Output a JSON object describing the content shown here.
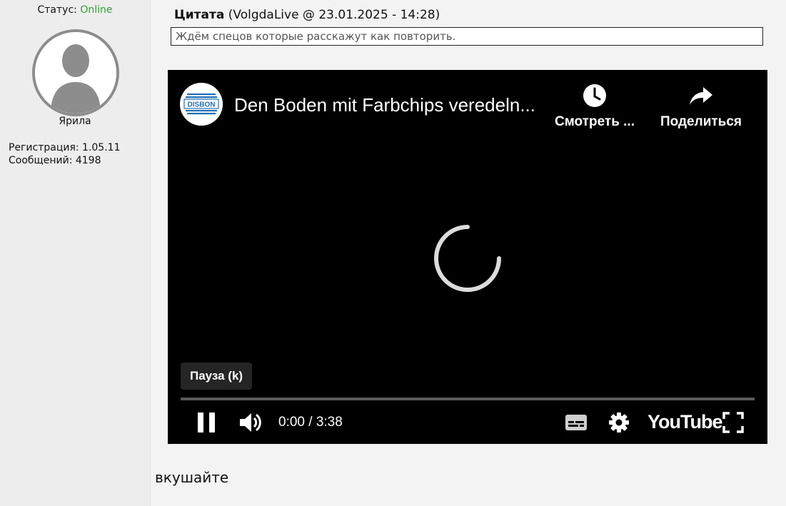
{
  "user": {
    "status_label": "Статус:",
    "status_value": "Online",
    "name": "Ярила",
    "registration": "Регистрация: 1.05.11",
    "messages": "Сообщений: 4198"
  },
  "quote": {
    "label": "Цитата",
    "source": "(VolgdaLive @ 23.01.2025 - 14:28)",
    "text": "Ждём спецов которые расскажут как повторить."
  },
  "video": {
    "channel_logo_text": "DISBON",
    "title": "Den Boden mit Farbchips veredeln...",
    "watch_later_label": "Смотреть ...",
    "share_label": "Поделиться",
    "tooltip": "Пауза (k)",
    "time": "0:00 / 3:38",
    "brand": "YouTube",
    "progress": 0
  },
  "reply": {
    "text": "вкушайте"
  },
  "colors": {
    "online": "#2aa52a",
    "brand_blue": "#1f6fb5"
  }
}
